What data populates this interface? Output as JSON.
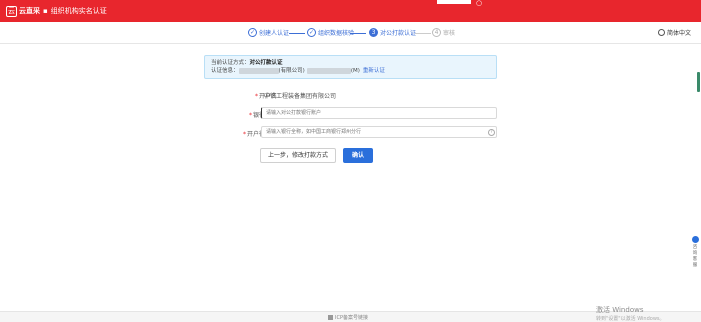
{
  "header": {
    "logo_badge": "云",
    "logo_text": "云直采",
    "separator": "▪",
    "title": "组织机构实名认证",
    "top_mark": "○"
  },
  "steps": [
    {
      "label": "创建人认证",
      "state": "done",
      "mark": "✓"
    },
    {
      "label": "组织数据核验",
      "state": "done",
      "mark": "✓"
    },
    {
      "label": "对公打款认证",
      "state": "current",
      "mark": "3"
    },
    {
      "label": "审核",
      "state": "pending",
      "mark": "4"
    }
  ],
  "language": {
    "label": "简体中文"
  },
  "notice": {
    "method_label": "当前认证方式：",
    "method_value": "对公打款认证",
    "info_label": "认证信息：",
    "info_mid": "(有限公司)",
    "info_end": "(M)",
    "reauth_link": "重新认证"
  },
  "form": {
    "account_name_label": "开户名",
    "account_name_value": "中铁工程装备集团有限公司",
    "bank_account_label": "银行账户",
    "bank_account_placeholder": "请输入对公打款银行账户",
    "bank_branch_label": "开户行支行",
    "bank_branch_placeholder": "请输入银行全称，如中国工商银行郑州分行",
    "help_icon": "?"
  },
  "buttons": {
    "prev_label": "上一步，修改打款方式",
    "confirm_label": "确认"
  },
  "side": {
    "help_text": "咨询客服"
  },
  "footer": {
    "text": "ICP备案号链接"
  },
  "os_watermark": {
    "line1": "激活 Windows",
    "line2": "转到\"设置\"以激活 Windows。"
  },
  "colors": {
    "brand_red": "#e8262d",
    "primary_blue": "#2a6fdb",
    "notice_bg": "#e9f5fd"
  }
}
